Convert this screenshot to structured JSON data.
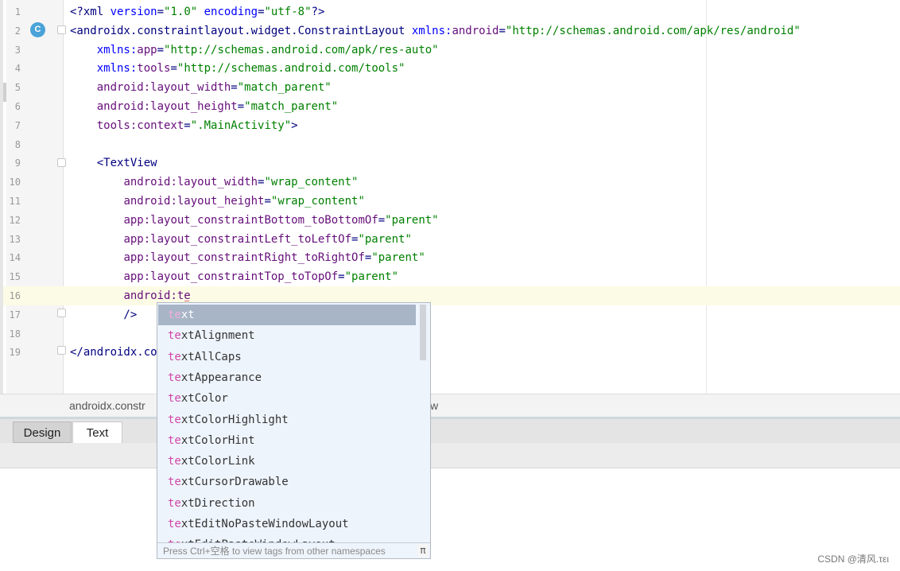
{
  "editor": {
    "lines": [
      {
        "n": "1",
        "segs": [
          [
            "c-tag",
            "<?xml "
          ],
          [
            "c-ns",
            "version"
          ],
          [
            "c-tag",
            "="
          ],
          [
            "c-val",
            "\"1.0\""
          ],
          [
            "c-tag",
            " "
          ],
          [
            "c-ns",
            "encoding"
          ],
          [
            "c-tag",
            "="
          ],
          [
            "c-val",
            "\"utf-8\""
          ],
          [
            "c-tag",
            "?>"
          ]
        ]
      },
      {
        "n": "2",
        "segs": [
          [
            "c-tag",
            "<androidx.constraintlayout.widget.ConstraintLayout "
          ],
          [
            "c-ns",
            "xmlns:"
          ],
          [
            "c-attr",
            "android"
          ],
          [
            "c-tag",
            "="
          ],
          [
            "c-val",
            "\"http://schemas.android.com/apk/res/android\""
          ]
        ]
      },
      {
        "n": "3",
        "segs": [
          [
            "c-tag",
            "    "
          ],
          [
            "c-ns",
            "xmlns:"
          ],
          [
            "c-attr",
            "app"
          ],
          [
            "c-tag",
            "="
          ],
          [
            "c-val",
            "\"http://schemas.android.com/apk/res-auto\""
          ]
        ]
      },
      {
        "n": "4",
        "segs": [
          [
            "c-tag",
            "    "
          ],
          [
            "c-ns",
            "xmlns:"
          ],
          [
            "c-attr",
            "tools"
          ],
          [
            "c-tag",
            "="
          ],
          [
            "c-val",
            "\"http://schemas.android.com/tools\""
          ]
        ]
      },
      {
        "n": "5",
        "segs": [
          [
            "c-tag",
            "    "
          ],
          [
            "c-attr",
            "android:layout_width"
          ],
          [
            "c-tag",
            "="
          ],
          [
            "c-val",
            "\"match_parent\""
          ]
        ]
      },
      {
        "n": "6",
        "segs": [
          [
            "c-tag",
            "    "
          ],
          [
            "c-attr",
            "android:layout_height"
          ],
          [
            "c-tag",
            "="
          ],
          [
            "c-val",
            "\"match_parent\""
          ]
        ]
      },
      {
        "n": "7",
        "segs": [
          [
            "c-tag",
            "    "
          ],
          [
            "c-attr",
            "tools:context"
          ],
          [
            "c-tag",
            "="
          ],
          [
            "c-val",
            "\".MainActivity\""
          ],
          [
            "c-tag",
            ">"
          ]
        ]
      },
      {
        "n": "8",
        "segs": []
      },
      {
        "n": "9",
        "segs": [
          [
            "c-tag",
            "    <TextView"
          ]
        ]
      },
      {
        "n": "10",
        "segs": [
          [
            "c-tag",
            "        "
          ],
          [
            "c-attr",
            "android:layout_width"
          ],
          [
            "c-tag",
            "="
          ],
          [
            "c-val",
            "\"wrap_content\""
          ]
        ]
      },
      {
        "n": "11",
        "segs": [
          [
            "c-tag",
            "        "
          ],
          [
            "c-attr",
            "android:layout_height"
          ],
          [
            "c-tag",
            "="
          ],
          [
            "c-val",
            "\"wrap_content\""
          ]
        ]
      },
      {
        "n": "12",
        "segs": [
          [
            "c-tag",
            "        "
          ],
          [
            "c-attr",
            "app:layout_constraintBottom_toBottomOf"
          ],
          [
            "c-tag",
            "="
          ],
          [
            "c-val",
            "\"parent\""
          ]
        ]
      },
      {
        "n": "13",
        "segs": [
          [
            "c-tag",
            "        "
          ],
          [
            "c-attr",
            "app:layout_constraintLeft_toLeftOf"
          ],
          [
            "c-tag",
            "="
          ],
          [
            "c-val",
            "\"parent\""
          ]
        ]
      },
      {
        "n": "14",
        "segs": [
          [
            "c-tag",
            "        "
          ],
          [
            "c-attr",
            "app:layout_constraintRight_toRightOf"
          ],
          [
            "c-tag",
            "="
          ],
          [
            "c-val",
            "\"parent\""
          ]
        ]
      },
      {
        "n": "15",
        "segs": [
          [
            "c-tag",
            "        "
          ],
          [
            "c-attr",
            "app:layout_constraintTop_toTopOf"
          ],
          [
            "c-tag",
            "="
          ],
          [
            "c-val",
            "\"parent\""
          ]
        ]
      },
      {
        "n": "16",
        "segs": [
          [
            "c-tag",
            "        "
          ],
          [
            "c-attr",
            "android:te"
          ]
        ]
      },
      {
        "n": "17",
        "segs": [
          [
            "c-tag",
            "        />"
          ]
        ]
      },
      {
        "n": "18",
        "segs": []
      },
      {
        "n": "19",
        "segs": [
          [
            "c-tag",
            "</androidx.con"
          ]
        ]
      }
    ]
  },
  "gutter_icon": {
    "letter": "C",
    "color": "#4aa3d8"
  },
  "breadcrumb": {
    "left": "androidx.constr",
    "right": "w"
  },
  "bottom_tabs": {
    "design": "Design",
    "text": "Text"
  },
  "completion": {
    "prefix": "te",
    "items": [
      "text",
      "textAlignment",
      "textAllCaps",
      "textAppearance",
      "textColor",
      "textColorHighlight",
      "textColorHint",
      "textColorLink",
      "textCursorDrawable",
      "textDirection",
      "textEditNoPasteWindowLayout",
      "textEditPasteWindowLayout"
    ],
    "selected": "text",
    "footer": "Press Ctrl+空格 to view tags from other namespaces",
    "pi_button": "π"
  },
  "watermark": "CSDN @清风.τει"
}
